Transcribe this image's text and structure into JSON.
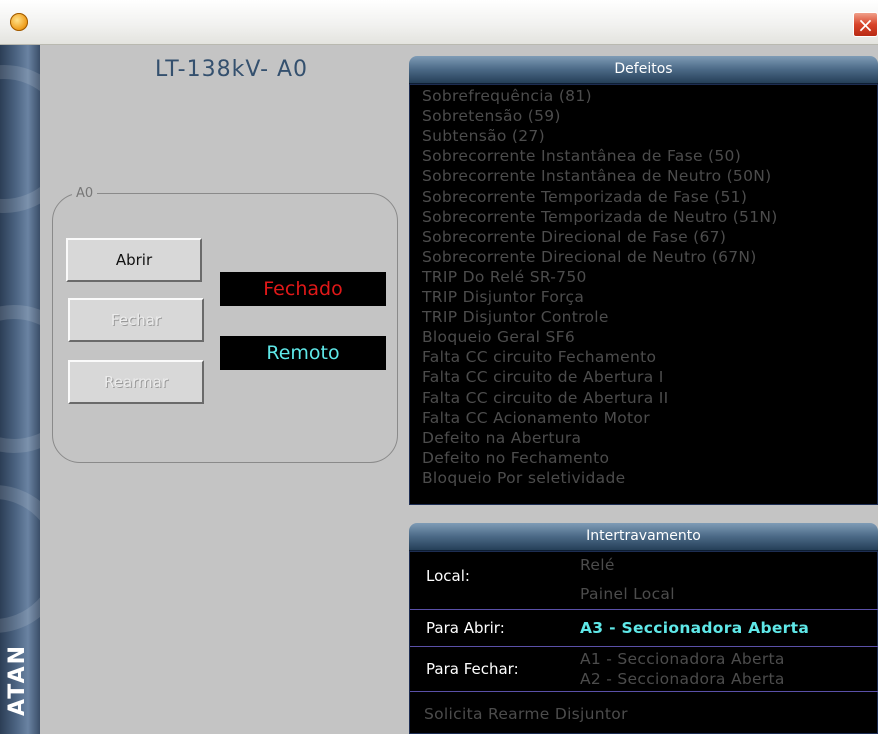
{
  "window": {
    "icon": "app-palette-icon",
    "close_label": "×"
  },
  "brand": {
    "text": "ATAN"
  },
  "device": {
    "title": "LT-138kV- A0"
  },
  "group": {
    "label": "A0",
    "buttons": {
      "abrir": "Abrir",
      "fechar": "Fechar",
      "rearmar": "Rearmar"
    },
    "status": {
      "state": "Fechado",
      "mode": "Remoto"
    }
  },
  "defeitos": {
    "header": "Defeitos",
    "items": [
      "Sobrefrequência (81)",
      "Sobretensão (59)",
      "Subtensão (27)",
      "Sobrecorrente Instantânea de Fase (50)",
      "Sobrecorrente Instantânea de Neutro (50N)",
      "Sobrecorrente Temporizada de Fase (51)",
      "Sobrecorrente Temporizada de Neutro (51N)",
      "Sobrecorrente Direcional de Fase (67)",
      "Sobrecorrente Direcional de Neutro (67N)",
      "TRIP Do Relé SR-750",
      "TRIP Disjuntor Força",
      "TRIP Disjuntor Controle",
      "Bloqueio Geral SF6",
      "Falta CC circuito Fechamento",
      "Falta CC circuito de Abertura I",
      "Falta CC circuito de Abertura II",
      "Falta CC Acionamento Motor",
      "Defeito na Abertura",
      "Defeito no Fechamento",
      "Bloqueio Por seletividade"
    ]
  },
  "intertravamento": {
    "header": "Intertravamento",
    "local": {
      "label": "Local:",
      "values": [
        "Relé",
        "Painel Local"
      ]
    },
    "para_abrir": {
      "label": "Para Abrir:",
      "values": [
        "A3 - Seccionadora Aberta"
      ]
    },
    "para_fechar": {
      "label": "Para Fechar:",
      "values": [
        "A1 - Seccionadora Aberta",
        "A2 - Seccionadora Aberta"
      ]
    },
    "solicita": "Solicita Rearme Disjuntor"
  },
  "colors": {
    "status_closed": "#e01818",
    "status_remote": "#5fe8e8",
    "inactive_text": "#4c4c4c",
    "active_text": "#5fe8e8"
  }
}
